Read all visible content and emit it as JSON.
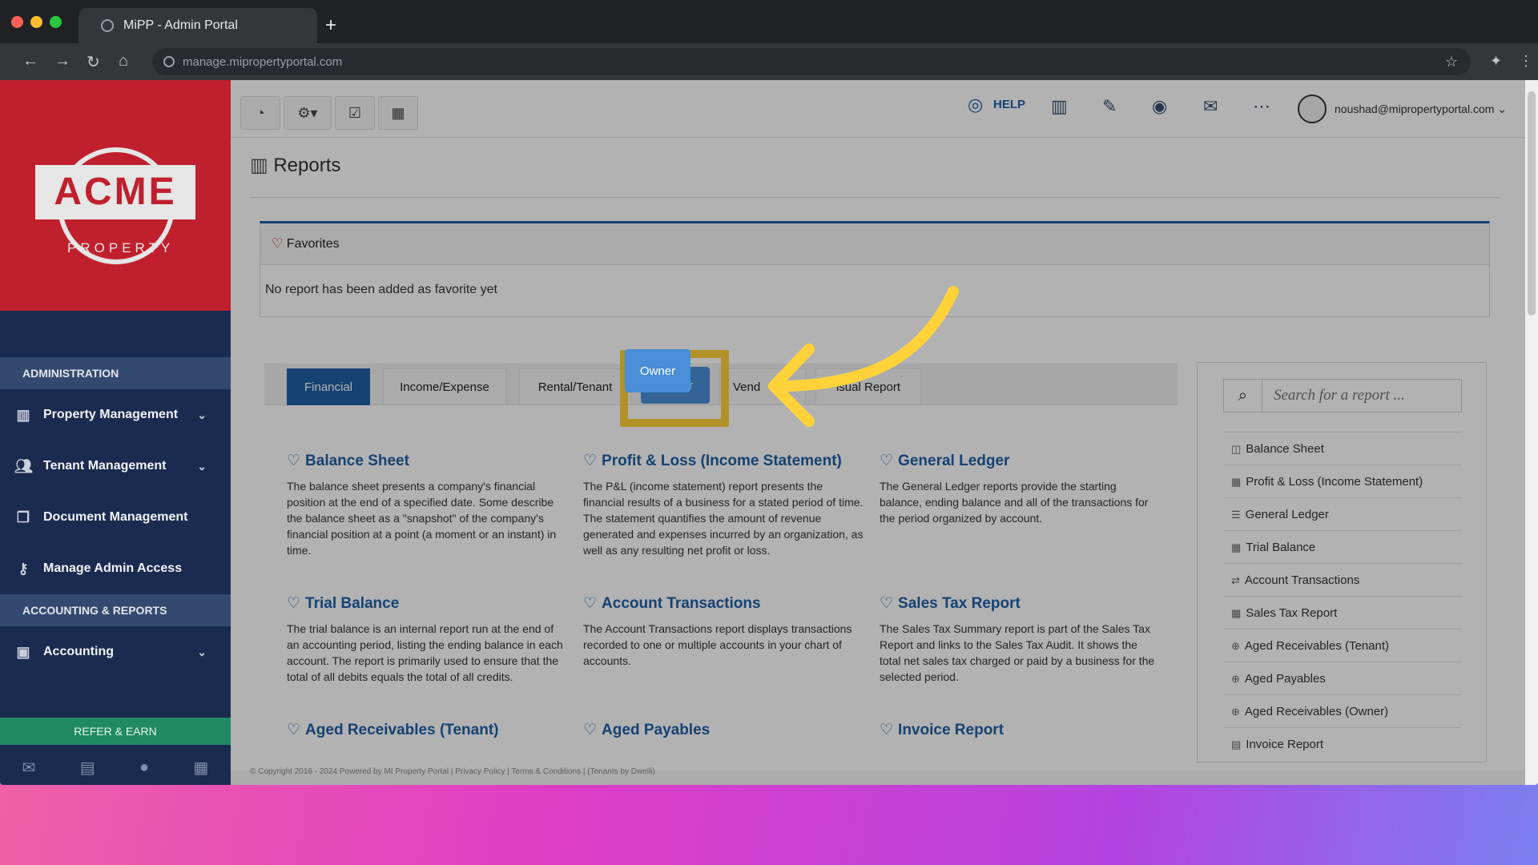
{
  "browser": {
    "tab_title": "MiPP - Admin Portal",
    "new_tab": "+",
    "url": "manage.mipropertyportal.com",
    "back": "←",
    "forward": "→",
    "reload": "↻",
    "home": "⌂",
    "star": "☆",
    "extensions": "✦",
    "menu": "⋮"
  },
  "sidebar": {
    "logo_main": "ACME",
    "logo_sub": "PROPERTY",
    "section_admin": "ADMINISTRATION",
    "section_accounting": "ACCOUNTING & REPORTS",
    "items": [
      {
        "label": "Property Management",
        "icon": "building-icon"
      },
      {
        "label": "Tenant Management",
        "icon": "users-icon"
      },
      {
        "label": "Document Management",
        "icon": "document-icon"
      },
      {
        "label": "Manage Admin Access",
        "icon": "key-icon"
      }
    ],
    "accounting": {
      "label": "Accounting",
      "icon": "money-icon"
    },
    "refer": "REFER & EARN"
  },
  "topbar": {
    "help": "HELP",
    "user_email": "noushad@mipropertyportal.com"
  },
  "page": {
    "title": "Reports",
    "favorites_title": "Favorites",
    "favorites_empty": "No report has been added as favorite yet"
  },
  "report_tabs": [
    "Financial",
    "Income/Expense",
    "Rental/Tenant",
    "Owner",
    "Vend",
    "isual Report"
  ],
  "cards": [
    {
      "title": "Balance Sheet",
      "desc": "The balance sheet presents a company's financial position at the end of a specified date. Some describe the balance sheet as a \"snapshot\" of the company's financial position at a point (a moment or an instant) in time."
    },
    {
      "title": "Profit & Loss (Income Statement)",
      "desc": "The P&L (income statement) report presents the financial results of a business for a stated period of time. The statement quantifies the amount of revenue generated and expenses incurred by an organization, as well as any resulting net profit or loss."
    },
    {
      "title": "General Ledger",
      "desc": "The General Ledger reports provide the starting balance, ending balance and all of the transactions for the period organized by account."
    },
    {
      "title": "Trial Balance",
      "desc": "The trial balance is an internal report run at the end of an accounting period, listing the ending balance in each account. The report is primarily used to ensure that the total of all debits equals the total of all credits."
    },
    {
      "title": "Account Transactions",
      "desc": "The Account Transactions report displays transactions recorded to one or multiple accounts in your chart of accounts."
    },
    {
      "title": "Sales Tax Report",
      "desc": "The Sales Tax Summary report is part of the Sales Tax Report and links to the Sales Tax Audit. It shows the total net sales tax charged or paid by a business for the selected period."
    },
    {
      "title": "Aged Receivables (Tenant)",
      "desc": ""
    },
    {
      "title": "Aged Payables",
      "desc": ""
    },
    {
      "title": "Invoice Report",
      "desc": ""
    }
  ],
  "search": {
    "placeholder": "Search for a report ..."
  },
  "report_list": [
    {
      "label": "Balance Sheet",
      "icon": "◫"
    },
    {
      "label": "Profit & Loss (Income Statement)",
      "icon": "▦"
    },
    {
      "label": "General Ledger",
      "icon": "☰"
    },
    {
      "label": "Trial Balance",
      "icon": "▦"
    },
    {
      "label": "Account Transactions",
      "icon": "⇄"
    },
    {
      "label": "Sales Tax Report",
      "icon": "▦"
    },
    {
      "label": "Aged Receivables (Tenant)",
      "icon": "⊕"
    },
    {
      "label": "Aged Payables",
      "icon": "⊕"
    },
    {
      "label": "Aged Receivables (Owner)",
      "icon": "⊕"
    },
    {
      "label": "Invoice Report",
      "icon": "▤"
    }
  ],
  "footer": "© Copyright 2016 - 2024 Powered by MI Property Portal | Privacy Policy | Terms & Conditions | (Tenants by Dwelli)",
  "colors": {
    "accent": "#1f5fa5",
    "highlight": "#ffd23a",
    "brand_red": "#c0202e",
    "sidebar": "#1b2a4f"
  }
}
